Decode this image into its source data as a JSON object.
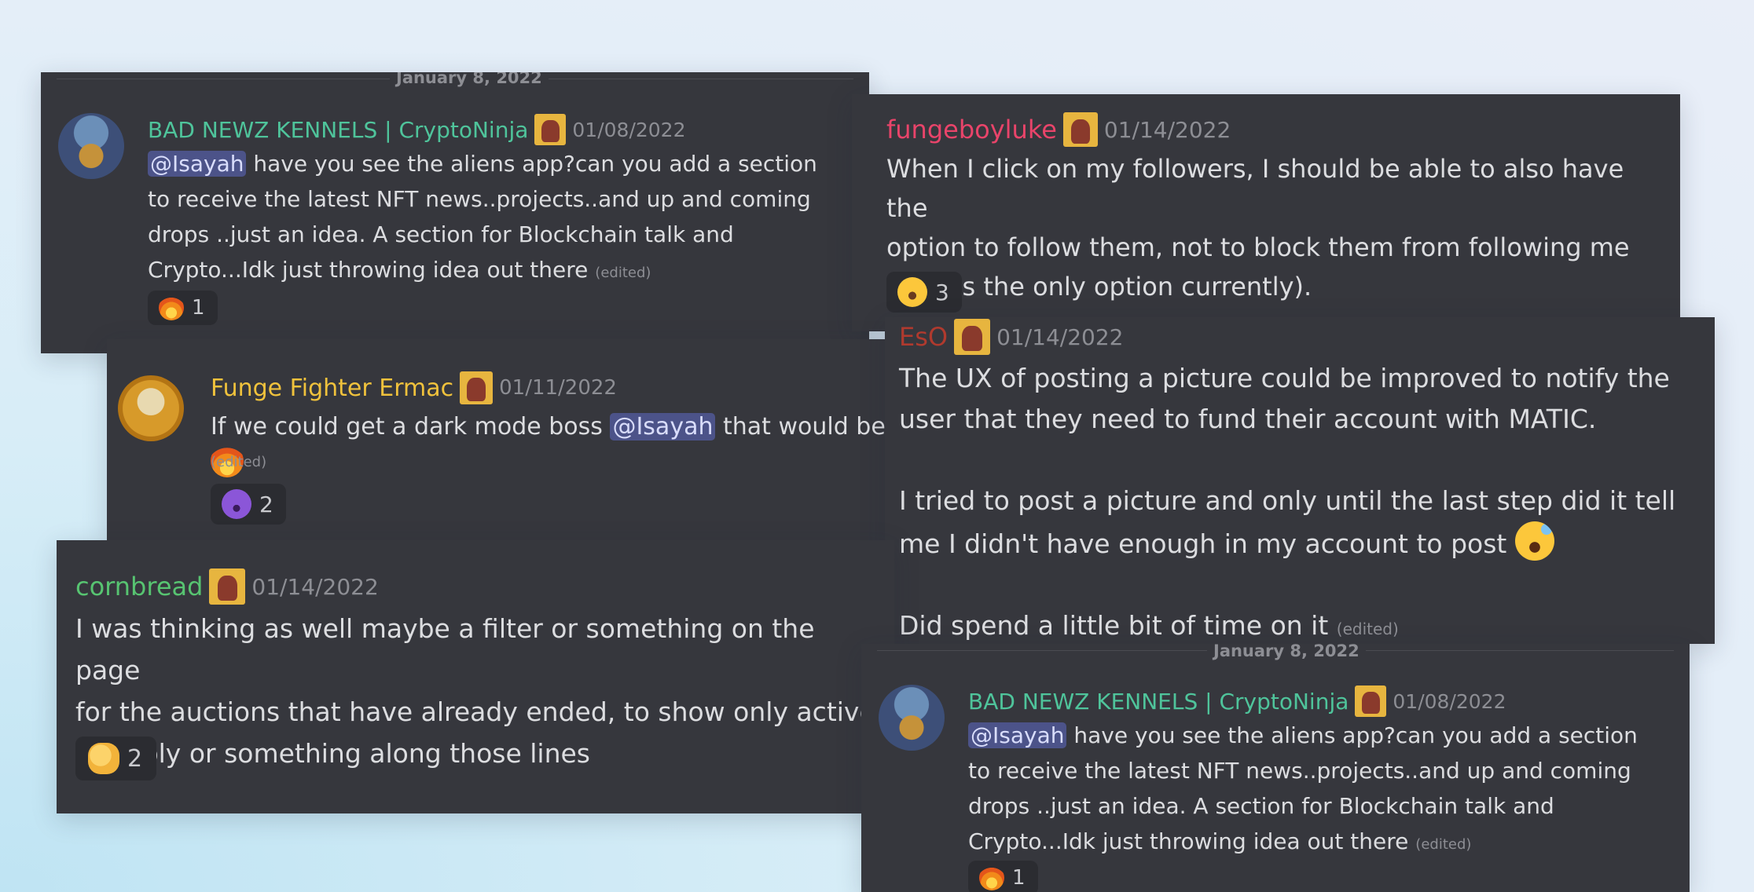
{
  "colors": {
    "card_bg": "#36373d",
    "mention_bg": "#4c5389",
    "name_green": "#4fc49b",
    "name_pink": "#e9446a",
    "name_gold": "#f0c23c",
    "name_red": "#b03a2e",
    "name_lightgreen": "#57c471"
  },
  "cards": [
    {
      "date_divider": "January 8, 2022",
      "username": "BAD NEWZ KENNELS | CryptoNinja",
      "timestamp": "01/08/2022",
      "mention": "@Isayah",
      "text": " have you see the aliens app?can you add a section\nto receive the latest NFT news..projects..and up and coming\ndrops ..just an idea. A section for Blockchain talk and\nCrypto...Idk just throwing idea out there ",
      "edited": "(edited)",
      "reaction_icon": "fire-emoji",
      "reaction_count": "1"
    },
    {
      "username": "fungeboyluke",
      "timestamp": "01/14/2022",
      "text": "When I click on my followers, I should be able to also have the\noption to follow them, not to block them from following me\n(that is the only option currently).",
      "reaction_icon": "laughing-emoji",
      "reaction_count": "3"
    },
    {
      "username": "Funge Fighter Ermac",
      "timestamp": "01/11/2022",
      "text_before": "If we could get a dark mode boss ",
      "mention": "@Isayah",
      "text_after": " that would be ",
      "inline_icon": "fire-emoji",
      "edited": "(edited)",
      "reaction_icon": "smiling-devil-emoji",
      "reaction_count": "2"
    },
    {
      "username": "EsO",
      "timestamp": "01/14/2022",
      "text": "The UX of posting a picture could be improved to notify the\nuser that they need to fund their account with MATIC.\n\nI tried to post a picture and only until the last step did it tell\nme I didn't have enough in my account to post ",
      "inline_icon": "sweat-smile-emoji",
      "text2": "\n\nDid spend a little bit of time on it ",
      "edited": "(edited)"
    },
    {
      "username": "cornbread",
      "timestamp": "01/14/2022",
      "text": "I was thinking as well maybe a filter or something on the page\nfor the auctions that have already ended, to show only active\npossibly or something along those lines",
      "reaction_icon": "clapping-hands-emoji",
      "reaction_count": "2"
    },
    {
      "date_divider": "January 8, 2022",
      "username": "BAD NEWZ KENNELS | CryptoNinja",
      "timestamp": "01/08/2022",
      "mention": "@Isayah",
      "text": " have you see the aliens app?can you add a section\nto receive the latest NFT news..projects..and up and coming\ndrops ..just an idea. A section for Blockchain talk and\nCrypto...Idk just throwing idea out there ",
      "edited": "(edited)",
      "reaction_icon": "fire-emoji",
      "reaction_count": "1"
    }
  ]
}
